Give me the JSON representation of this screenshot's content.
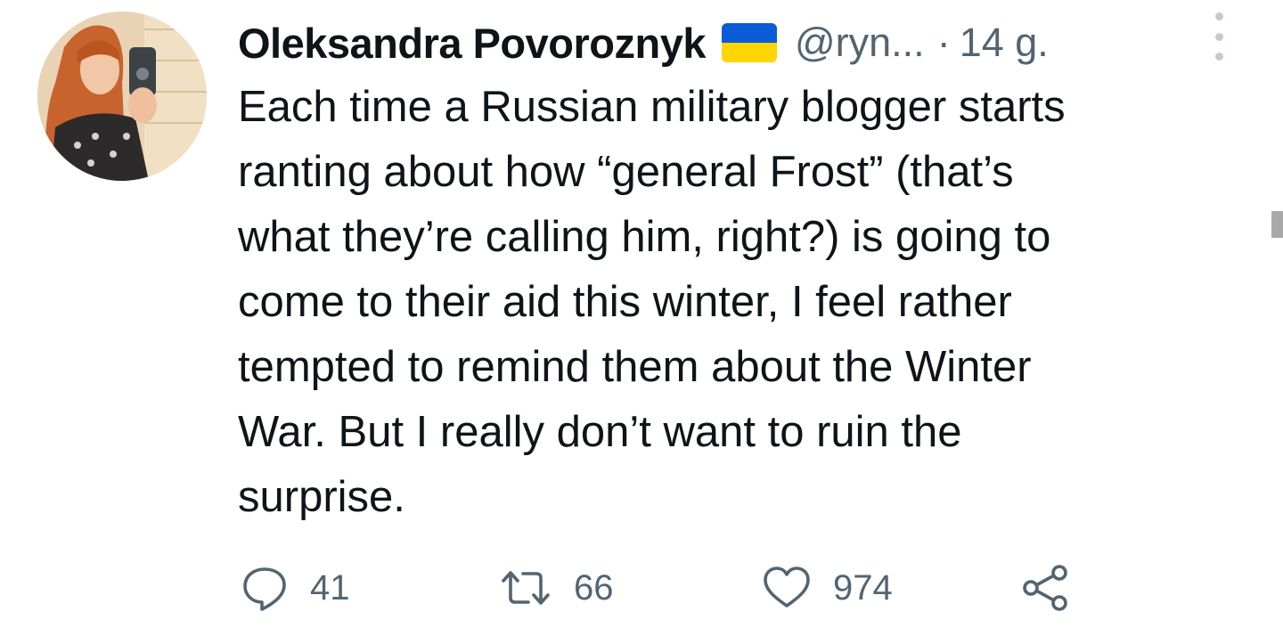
{
  "tweet": {
    "author": {
      "name": "Oleksandra Povoroznyk",
      "handle": "@ryn...",
      "flag_icon": "ukraine-flag-icon",
      "flag_colors": [
        "#0a5bd6",
        "#ffd500"
      ]
    },
    "separator": "·",
    "time": "14 g.",
    "text": "Each time a Russian military blogger starts\nranting about how “general Frost” (that’s\nwhat they’re calling him, right?) is going to\ncome to their aid this winter, I feel rather\ntempted to remind them about the Winter\nWar. But I really don’t want to ruin the\nsurprise.",
    "actions": {
      "reply": {
        "icon": "reply-icon",
        "count": "41"
      },
      "retweet": {
        "icon": "retweet-icon",
        "count": "66"
      },
      "like": {
        "icon": "heart-icon",
        "count": "974"
      },
      "share": {
        "icon": "share-icon"
      }
    }
  },
  "colors": {
    "text": "#0f1419",
    "secondary": "#536471",
    "background": "#ffffff"
  }
}
